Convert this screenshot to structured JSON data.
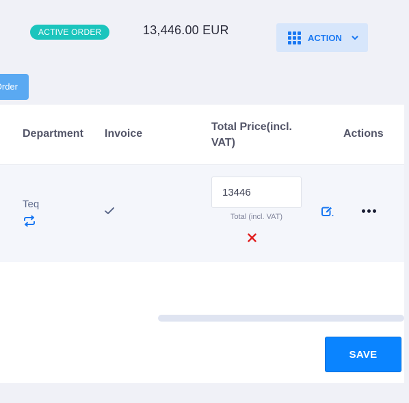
{
  "header": {
    "status_badge": "ACTIVE ORDER",
    "total_amount": "13,446.00 EUR",
    "action_label": "ACTION",
    "order_button_label": "Order"
  },
  "table": {
    "columns": [
      "Department",
      "Invoice",
      "Total Price(incl. VAT)",
      "Actions"
    ],
    "rows": [
      {
        "department": "Teq",
        "total_price_value": "13446",
        "total_price_hint": "Total (incl. VAT)"
      }
    ]
  },
  "footer": {
    "save_label": "SAVE"
  },
  "icons": {
    "action": "grid-icon",
    "action_chevron": "chevron-down-icon",
    "department_swap": "swap-icon",
    "invoice": "check-icon",
    "price_error": "x-icon",
    "edit": "edit-icon",
    "more": "more-horizontal-icon"
  },
  "colors": {
    "badge": "#1bc5bd",
    "primary": "#0a84ff",
    "action_bg": "#d7e6fb",
    "error": "#e01e1e"
  }
}
